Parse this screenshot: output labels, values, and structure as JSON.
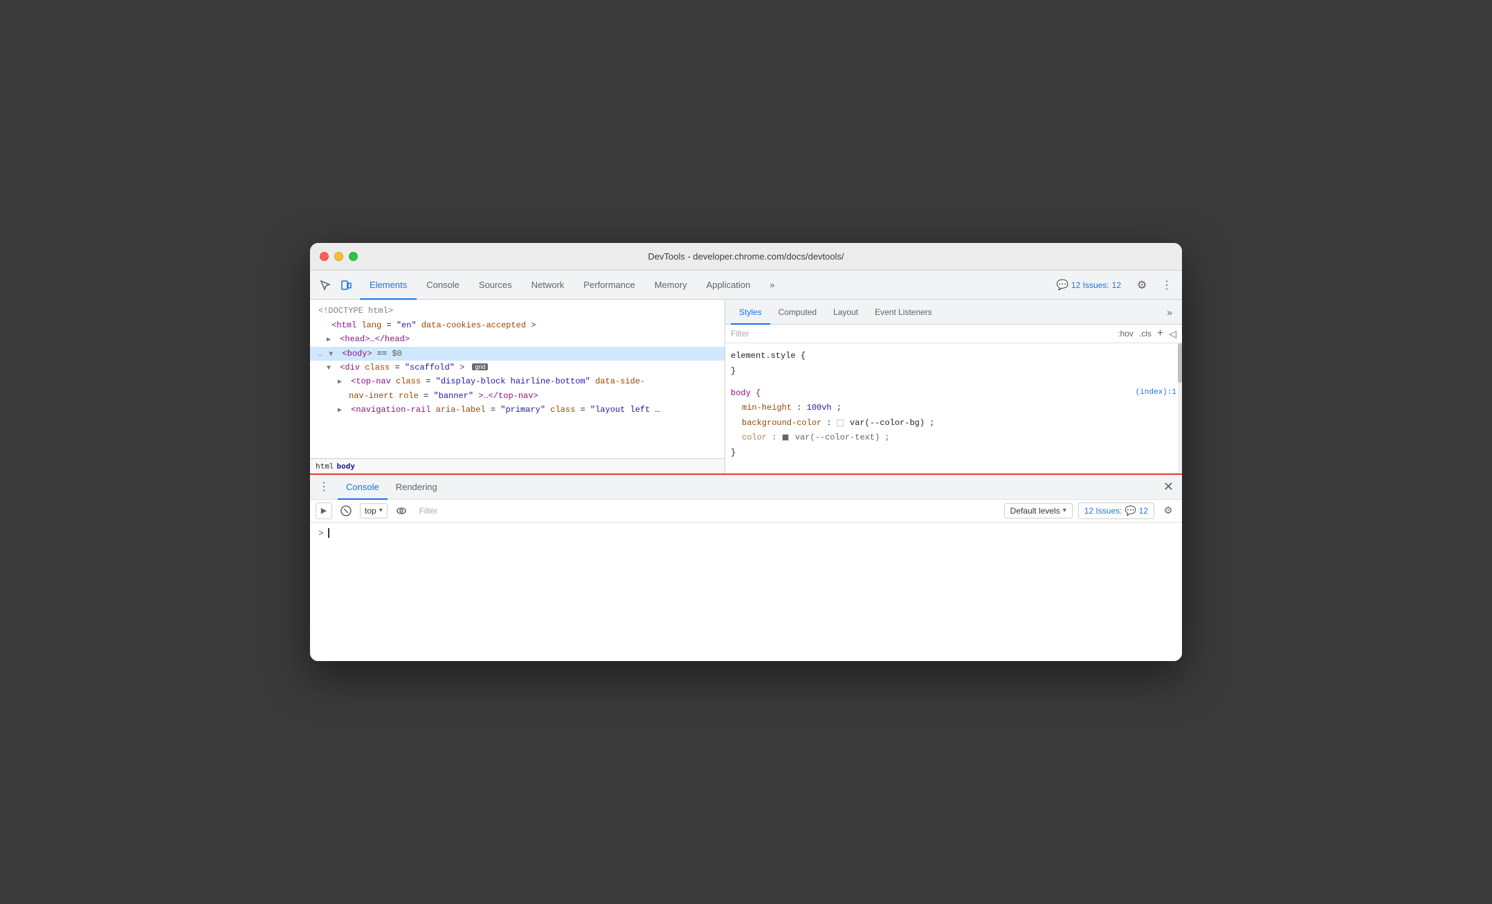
{
  "window": {
    "title": "DevTools - developer.chrome.com/docs/devtools/"
  },
  "titlebar": {
    "traffic": [
      "red",
      "yellow",
      "green"
    ]
  },
  "main_toolbar": {
    "tabs": [
      {
        "label": "Elements",
        "active": true
      },
      {
        "label": "Console",
        "active": false
      },
      {
        "label": "Sources",
        "active": false
      },
      {
        "label": "Network",
        "active": false
      },
      {
        "label": "Performance",
        "active": false
      },
      {
        "label": "Memory",
        "active": false
      },
      {
        "label": "Application",
        "active": false
      }
    ],
    "more_label": "»",
    "issues_count": "12",
    "issues_label": "12 Issues:",
    "settings_icon": "⚙",
    "more_dots_icon": "⋮"
  },
  "dom_panel": {
    "lines": [
      {
        "text": "<!DOCTYPE html>",
        "indent": 0,
        "type": "comment"
      },
      {
        "text": "<html lang=\"en\" data-cookies-accepted>",
        "indent": 0,
        "type": "tag"
      },
      {
        "text": "▶<head>…</head>",
        "indent": 1,
        "type": "tag"
      },
      {
        "text": "▼<body> == $0",
        "indent": 0,
        "type": "tag",
        "selected": true
      },
      {
        "text": "▼<div class=\"scaffold\">",
        "indent": 1,
        "type": "tag",
        "badge": "grid"
      },
      {
        "text": "▶<top-nav class=\"display-block hairline-bottom\" data-side-nav-inert role=\"banner\">…</top-nav>",
        "indent": 2,
        "type": "tag"
      },
      {
        "text": "▶<navigation-rail aria-label=\"primary\" class=\"layout left …",
        "indent": 2,
        "type": "tag"
      }
    ],
    "breadcrumbs": [
      "html",
      "body"
    ]
  },
  "styles_panel": {
    "tabs": [
      {
        "label": "Styles",
        "active": true
      },
      {
        "label": "Computed",
        "active": false
      },
      {
        "label": "Layout",
        "active": false
      },
      {
        "label": "Event Listeners",
        "active": false
      }
    ],
    "more_label": "»",
    "filter_placeholder": "Filter",
    "filter_hov": ":hov",
    "filter_cls": ".cls",
    "filter_plus": "+",
    "filter_inspect": "◁",
    "rules": [
      {
        "selector": "element.style {",
        "closing": "}",
        "source": "",
        "properties": []
      },
      {
        "selector": "body {",
        "closing": "}",
        "source": "(index):1",
        "properties": [
          {
            "name": "min-height",
            "value": "100vh",
            "color": null
          },
          {
            "name": "background-color",
            "value": "var(--color-bg)",
            "color": "white"
          },
          {
            "name": "color:",
            "value": "var(--color-text)",
            "color": "dark",
            "truncated": true
          }
        ]
      }
    ]
  },
  "bottom_drawer": {
    "tabs": [
      {
        "label": "Console",
        "active": true
      },
      {
        "label": "Rendering",
        "active": false
      }
    ],
    "close_icon": "✕",
    "console_toolbar": {
      "execute_icon": "▶",
      "clear_icon": "🚫",
      "context_label": "top",
      "context_arrow": "▾",
      "eye_icon": "👁",
      "filter_placeholder": "Filter",
      "levels_label": "Default levels",
      "levels_arrow": "▾",
      "issues_label": "12 Issues:",
      "issues_count": "12",
      "settings_icon": "⚙"
    },
    "console_output": {
      "prompt_chevron": ">",
      "cursor": ""
    }
  }
}
